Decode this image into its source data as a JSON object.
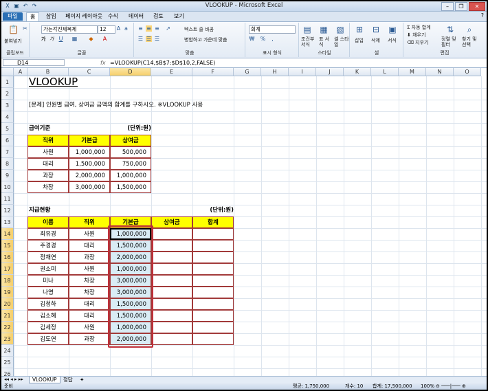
{
  "window": {
    "title": "VLOOKUP - Microsoft Excel"
  },
  "tabs": [
    "파일",
    "홈",
    "삽입",
    "페이지 레이아웃",
    "수식",
    "데이터",
    "검토",
    "보기"
  ],
  "ribbon": {
    "clipboard": {
      "label": "클립보드",
      "paste": "붙여넣기"
    },
    "font": {
      "label": "글꼴",
      "font_name": "가는각진제목체",
      "font_size": "12",
      "bold": "가",
      "italic": "가"
    },
    "alignment": {
      "label": "맞춤",
      "wrap": "텍스트 줄 바꿈",
      "merge": "병합하고 가운데 맞춤"
    },
    "number": {
      "label": "표시 형식",
      "format": "회계"
    },
    "styles": {
      "label": "스타일",
      "conditional": "조건부 서식",
      "table": "표 서식",
      "cell": "셀 스타일"
    },
    "cells": {
      "label": "셀",
      "insert": "삽입",
      "delete": "삭제",
      "format": "서식"
    },
    "editing": {
      "label": "편집",
      "autosum": "자동 합계",
      "fill": "채우기",
      "clear": "지우기",
      "sort": "정렬 및 필터",
      "find": "찾기 및 선택"
    }
  },
  "formula_bar": {
    "name_box": "D14",
    "fx": "fx",
    "formula": "=VLOOKUP(C14,$B$7:$D$10,2,FALSE)"
  },
  "columns": [
    "A",
    "B",
    "C",
    "D",
    "E",
    "F",
    "G",
    "H",
    "I",
    "J",
    "K",
    "L",
    "M",
    "N",
    "O"
  ],
  "rows": [
    "1",
    "2",
    "3",
    "4",
    "5",
    "6",
    "7",
    "8",
    "9",
    "10",
    "11",
    "12",
    "13",
    "14",
    "15",
    "16",
    "17",
    "18",
    "19",
    "20",
    "21",
    "22",
    "23",
    "24",
    "25",
    "26"
  ],
  "sheet": {
    "title": "VLOOKUP",
    "instruction": "[문제] 인원별 급여, 상여금 금액의 합계를 구하시오. ※VLOOKUP 사용",
    "table1_label": "급여기준",
    "table1_unit": "(단위:원)",
    "table1_headers": [
      "직위",
      "기본급",
      "상여금"
    ],
    "table1_rows": [
      [
        "사원",
        "1,000,000",
        "500,000"
      ],
      [
        "대리",
        "1,500,000",
        "750,000"
      ],
      [
        "과장",
        "2,000,000",
        "1,000,000"
      ],
      [
        "차장",
        "3,000,000",
        "1,500,000"
      ]
    ],
    "table2_label": "지급현황",
    "table2_unit": "(단위:원)",
    "table2_headers": [
      "이름",
      "직위",
      "기본급",
      "상여금",
      "합계"
    ],
    "table2_rows": [
      [
        "최유경",
        "사원",
        "1,000,000"
      ],
      [
        "주경경",
        "대리",
        "1,500,000"
      ],
      [
        "정채연",
        "과장",
        "2,000,000"
      ],
      [
        "권소미",
        "사원",
        "1,000,000"
      ],
      [
        "미나",
        "차장",
        "3,000,000"
      ],
      [
        "나영",
        "차장",
        "3,000,000"
      ],
      [
        "김청하",
        "대리",
        "1,500,000"
      ],
      [
        "김소혜",
        "대리",
        "1,500,000"
      ],
      [
        "김세정",
        "사원",
        "1,000,000"
      ],
      [
        "김도연",
        "과장",
        "2,000,000"
      ]
    ]
  },
  "sheet_tabs": [
    "VLOOKUP",
    "정답"
  ],
  "status": {
    "ready": "준비",
    "average": "평균: 1,750,000",
    "count": "개수: 10",
    "sum": "합계: 17,500,000",
    "zoom": "100%"
  }
}
